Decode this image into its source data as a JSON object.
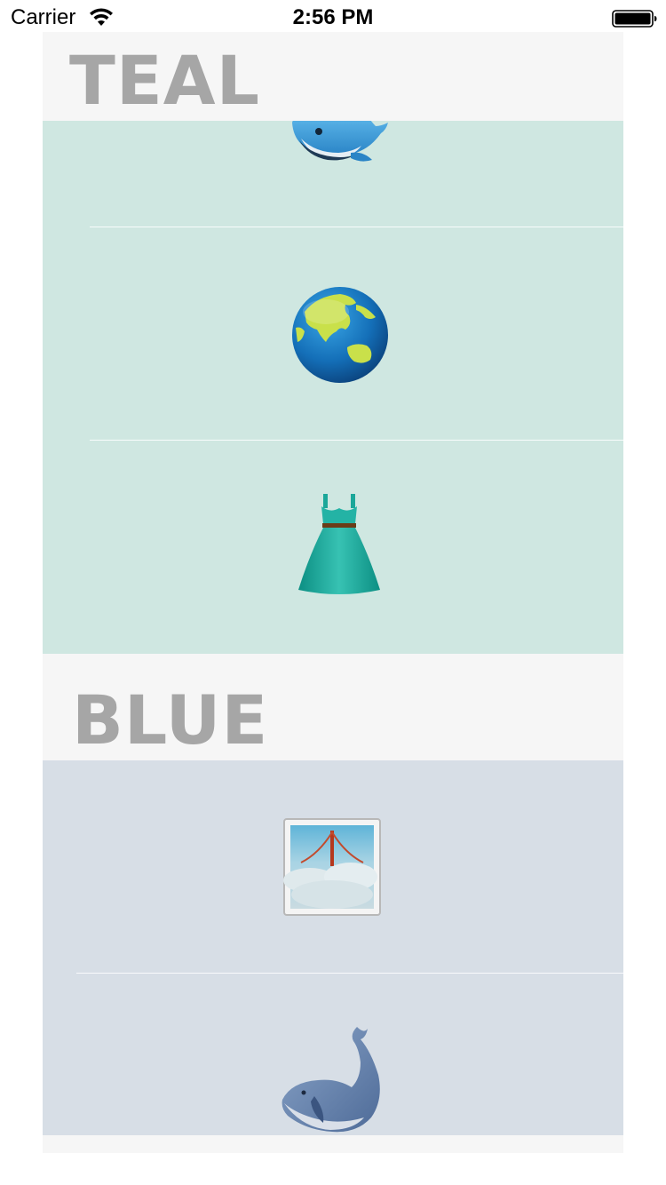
{
  "status_bar": {
    "carrier": "Carrier",
    "time": "2:56 PM",
    "wifi_icon": "wifi-icon",
    "battery_icon": "battery-icon"
  },
  "sections": [
    {
      "title": "TEAL",
      "color": "#cfe7e1",
      "rows": [
        {
          "icon": "whale-spouting-icon"
        },
        {
          "icon": "globe-asia-australia-icon"
        },
        {
          "icon": "dress-icon"
        }
      ]
    },
    {
      "title": "BLUE",
      "color": "#d7dee6",
      "rows": [
        {
          "icon": "foggy-bridge-icon"
        },
        {
          "icon": "whale-icon"
        }
      ]
    }
  ],
  "colors": {
    "header_background": "#f6f6f6",
    "header_text": "#a6a6a6",
    "teal_cell": "#cfe7e1",
    "blue_cell": "#d7dee6"
  }
}
